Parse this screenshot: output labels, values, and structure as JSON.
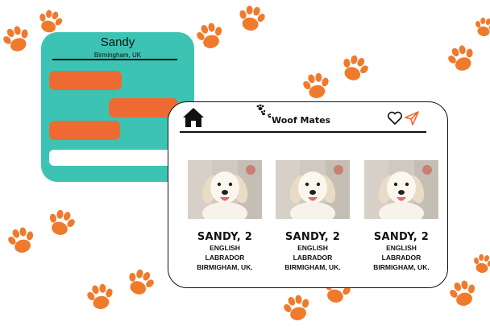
{
  "chat": {
    "name": "Sandy",
    "location": "Birmingham, UK"
  },
  "app": {
    "logo_text": "Woof Mates",
    "icons": [
      "home-icon",
      "heart-icon",
      "send-icon"
    ]
  },
  "dogs": [
    {
      "name": "SANDY, 2",
      "breed_line1": "ENGLISH",
      "breed_line2": "LABRADOR",
      "location": "BIRMIGHAM, UK."
    },
    {
      "name": "SANDY, 2",
      "breed_line1": "ENGLISH",
      "breed_line2": "LABRADOR",
      "location": "BIRMIGHAM, UK."
    },
    {
      "name": "SANDY, 2",
      "breed_line1": "ENGLISH",
      "breed_line2": "LABRADOR",
      "location": "BIRMIGHAM, UK."
    }
  ],
  "colors": {
    "teal": "#3cc3b3",
    "orange": "#ee6a32",
    "paw": "#f07a2c"
  }
}
